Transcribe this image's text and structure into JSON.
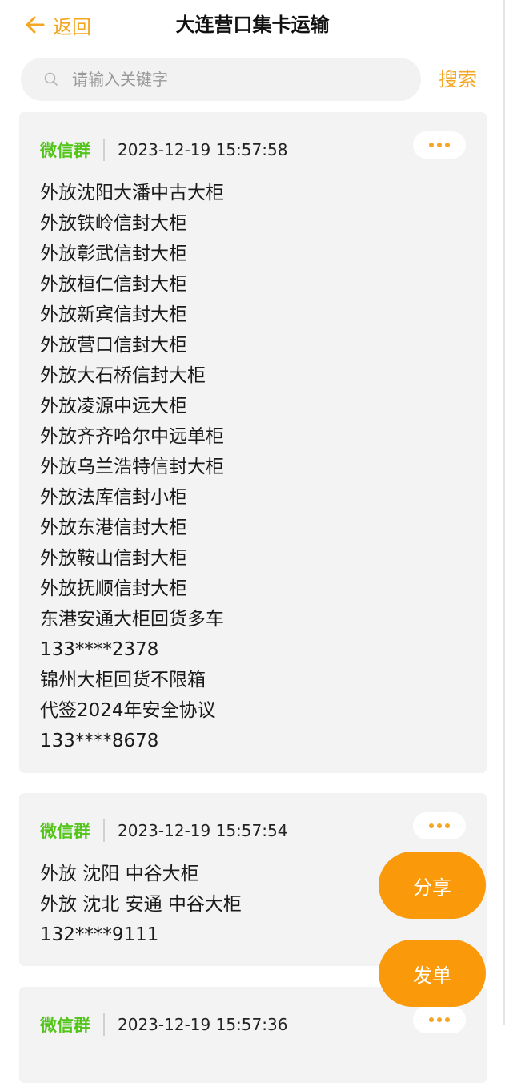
{
  "header": {
    "back_label": "返回",
    "title": "大连营口集卡运输"
  },
  "search": {
    "placeholder": "请输入关键字",
    "button_label": "搜索"
  },
  "posts": [
    {
      "source": "微信群",
      "time": "2023-12-19 15:57:58",
      "lines": [
        "外放沈阳大潘中古大柜",
        "外放铁岭信封大柜",
        "外放彰武信封大柜",
        "外放桓仁信封大柜",
        "外放新宾信封大柜",
        "外放营口信封大柜",
        "外放大石桥信封大柜",
        "外放凌源中远大柜",
        "外放齐齐哈尔中远单柜",
        "外放乌兰浩特信封大柜",
        "外放法库信封小柜",
        "外放东港信封大柜",
        "外放鞍山信封大柜",
        "外放抚顺信封大柜",
        "东港安通大柜回货多车",
        "133****2378",
        "锦州大柜回货不限箱",
        "代签2024年安全协议",
        "133****8678"
      ]
    },
    {
      "source": "微信群",
      "time": "2023-12-19 15:57:54",
      "lines": [
        "外放 沈阳 中谷大柜",
        "外放 沈北 安通 中谷大柜",
        "132****9111"
      ]
    },
    {
      "source": "微信群",
      "time": "2023-12-19 15:57:36",
      "lines": []
    }
  ],
  "fab": {
    "share_label": "分享",
    "post_label": "发单"
  },
  "colors": {
    "accent": "#f5a623",
    "fab": "#fa9a0a",
    "source_green": "#52c41a",
    "card_bg": "#f3f3f3"
  }
}
